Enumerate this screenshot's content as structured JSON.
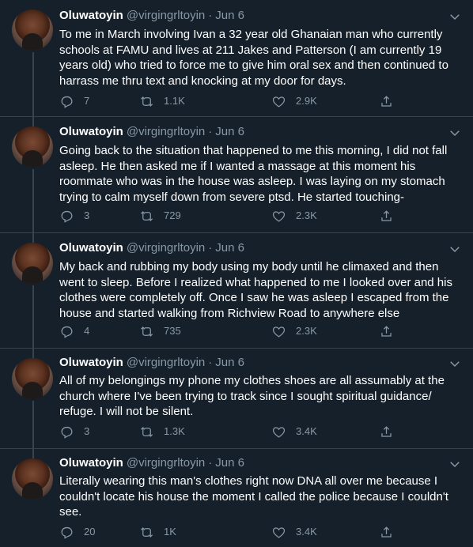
{
  "tweets": [
    {
      "name": "Oluwatoyin",
      "handle": "@virgingrltoyin",
      "date": "Jun 6",
      "text": "To me in March involving Ivan a 32 year old Ghanaian man who currently schools at FAMU and lives at 211 Jakes and Patterson (I am currently 19 years old) who tried to force me to give him oral sex and then continued to harrass me thru text and knocking at my door for days.",
      "replies": "7",
      "retweets": "1.1K",
      "likes": "2.9K"
    },
    {
      "name": "Oluwatoyin",
      "handle": "@virgingrltoyin",
      "date": "Jun 6",
      "text": "Going back to the situation that happened to me this morning, I did not fall asleep. He then asked me if I wanted a massage at this moment his roommate who was in the house was asleep. I was laying on my stomach trying to calm myself down from severe ptsd. He started touching-",
      "replies": "3",
      "retweets": "729",
      "likes": "2.3K"
    },
    {
      "name": "Oluwatoyin",
      "handle": "@virgingrltoyin",
      "date": "Jun 6",
      "text": "My back and rubbing my body using my body until he climaxed and then went to sleep. Before I realized what happened to me I looked over and his clothes were completely off. Once I saw he was asleep I escaped from the house and started walking from Richview Road to anywhere else",
      "replies": "4",
      "retweets": "735",
      "likes": "2.3K"
    },
    {
      "name": "Oluwatoyin",
      "handle": "@virgingrltoyin",
      "date": "Jun 6",
      "text": "All of my belongings my phone my clothes shoes are all assumably at the church where I've been trying to track since I sought spiritual guidance/ refuge. I will not be silent.",
      "replies": "3",
      "retweets": "1.3K",
      "likes": "3.4K"
    },
    {
      "name": "Oluwatoyin",
      "handle": "@virgingrltoyin",
      "date": "Jun 6",
      "text": "Literally wearing this man's clothes right now DNA all over me because I couldn't locate his house the moment I called the police because I couldn't see.",
      "replies": "20",
      "retweets": "1K",
      "likes": "3.4K"
    }
  ],
  "colors": {
    "background": "#15202b",
    "secondary_text": "#8899a6",
    "divider": "#38444d"
  },
  "icons": [
    "reply-icon",
    "retweet-icon",
    "like-icon",
    "share-icon",
    "caret-down-icon"
  ]
}
